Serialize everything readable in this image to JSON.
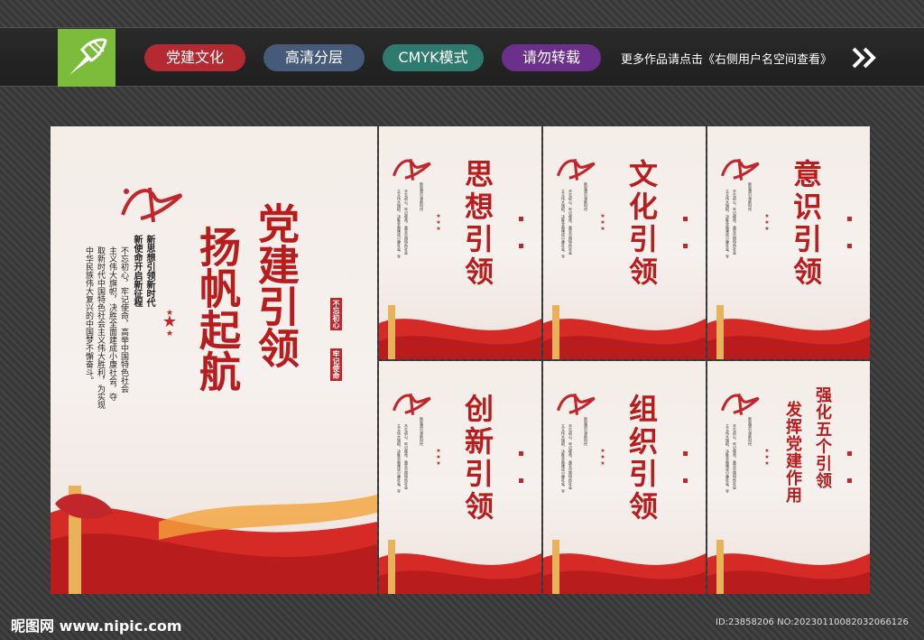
{
  "header": {
    "tags": [
      "党建文化",
      "高清分层",
      "CMYK模式",
      "请勿转载"
    ],
    "hint": "更多作品请点击《右侧用户名空间查看》"
  },
  "main_poster": {
    "title_col1": "党建引领",
    "title_col2": "扬帆起航",
    "seal_1": "不忘初心",
    "seal_2": "牢记使命",
    "sub_1": "新思想引领新时代",
    "sub_2": "新使命开启新征程",
    "body": [
      "不忘初心，牢记使命，高举中国特色社会",
      "主义伟大旗帜，决胜全面建成小康社会，夺",
      "取新时代中国特色社会主义伟大胜利，为实现",
      "中华民族伟大复兴的中国梦不懈奋斗。"
    ]
  },
  "small_posters": [
    {
      "title": "思想引领"
    },
    {
      "title": "文化引领"
    },
    {
      "title": "意识引领"
    },
    {
      "title": "创新引领"
    },
    {
      "title": "组织引领"
    },
    {
      "title_1": "强化五个引领",
      "title_2": "发挥党建作用"
    }
  ],
  "footer": {
    "site": "昵图网 www.nipic.com",
    "id": "ID:23858206 NO:20230110082032066126"
  },
  "colors": {
    "red": "#b81c1c",
    "green": "#7dbb3a"
  }
}
